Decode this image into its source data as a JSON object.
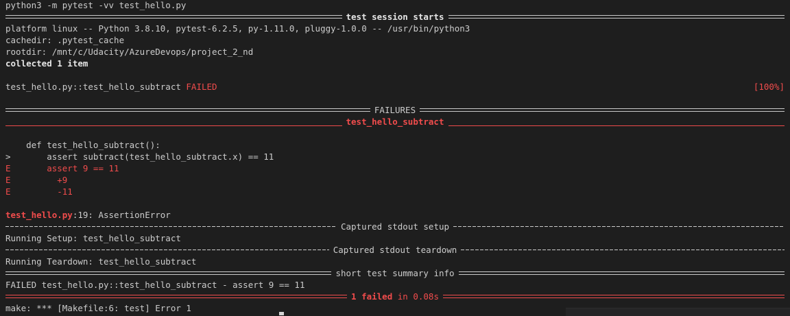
{
  "terminal": {
    "command": "python3 -m pytest -vv test_hello.py",
    "session_header": "test session starts",
    "platform": "platform linux -- Python 3.8.10, pytest-6.2.5, py-1.11.0, pluggy-1.0.0 -- /usr/bin/python3",
    "cachedir": "cachedir: .pytest_cache",
    "rootdir": "rootdir: /mnt/c/Udacity/AzureDevops/project_2_nd",
    "collected": "collected 1 item",
    "test_id": "test_hello.py::test_hello_subtract",
    "test_status": "FAILED",
    "test_progress": "[100%]",
    "failures_header": "FAILURES",
    "failure_name": "test_hello_subtract",
    "code_lines": [
      "    def test_hello_subtract():",
      ">       assert subtract(test_hello_subtract.x) == 11"
    ],
    "error_lines": [
      "E       assert 9 == 11",
      "E         +9",
      "E         -11"
    ],
    "error_file": "test_hello.py",
    "error_location": ":19: AssertionError",
    "stdout_setup_header": "Captured stdout setup",
    "stdout_setup_text": "Running Setup: test_hello_subtract",
    "stdout_teardown_header": "Captured stdout teardown",
    "stdout_teardown_text": "Running Teardown: test_hello_subtract",
    "summary_header": "short test summary info",
    "summary_line": "FAILED test_hello.py::test_hello_subtract - assert 9 == 11",
    "result_failed": "1 failed",
    "result_time": " in 0.08s",
    "make_line": "make: *** [Makefile:6: test] Error 1"
  },
  "colors": {
    "background": "#1e1e1e",
    "text": "#cccccc",
    "error_red": "#f14c4c"
  }
}
